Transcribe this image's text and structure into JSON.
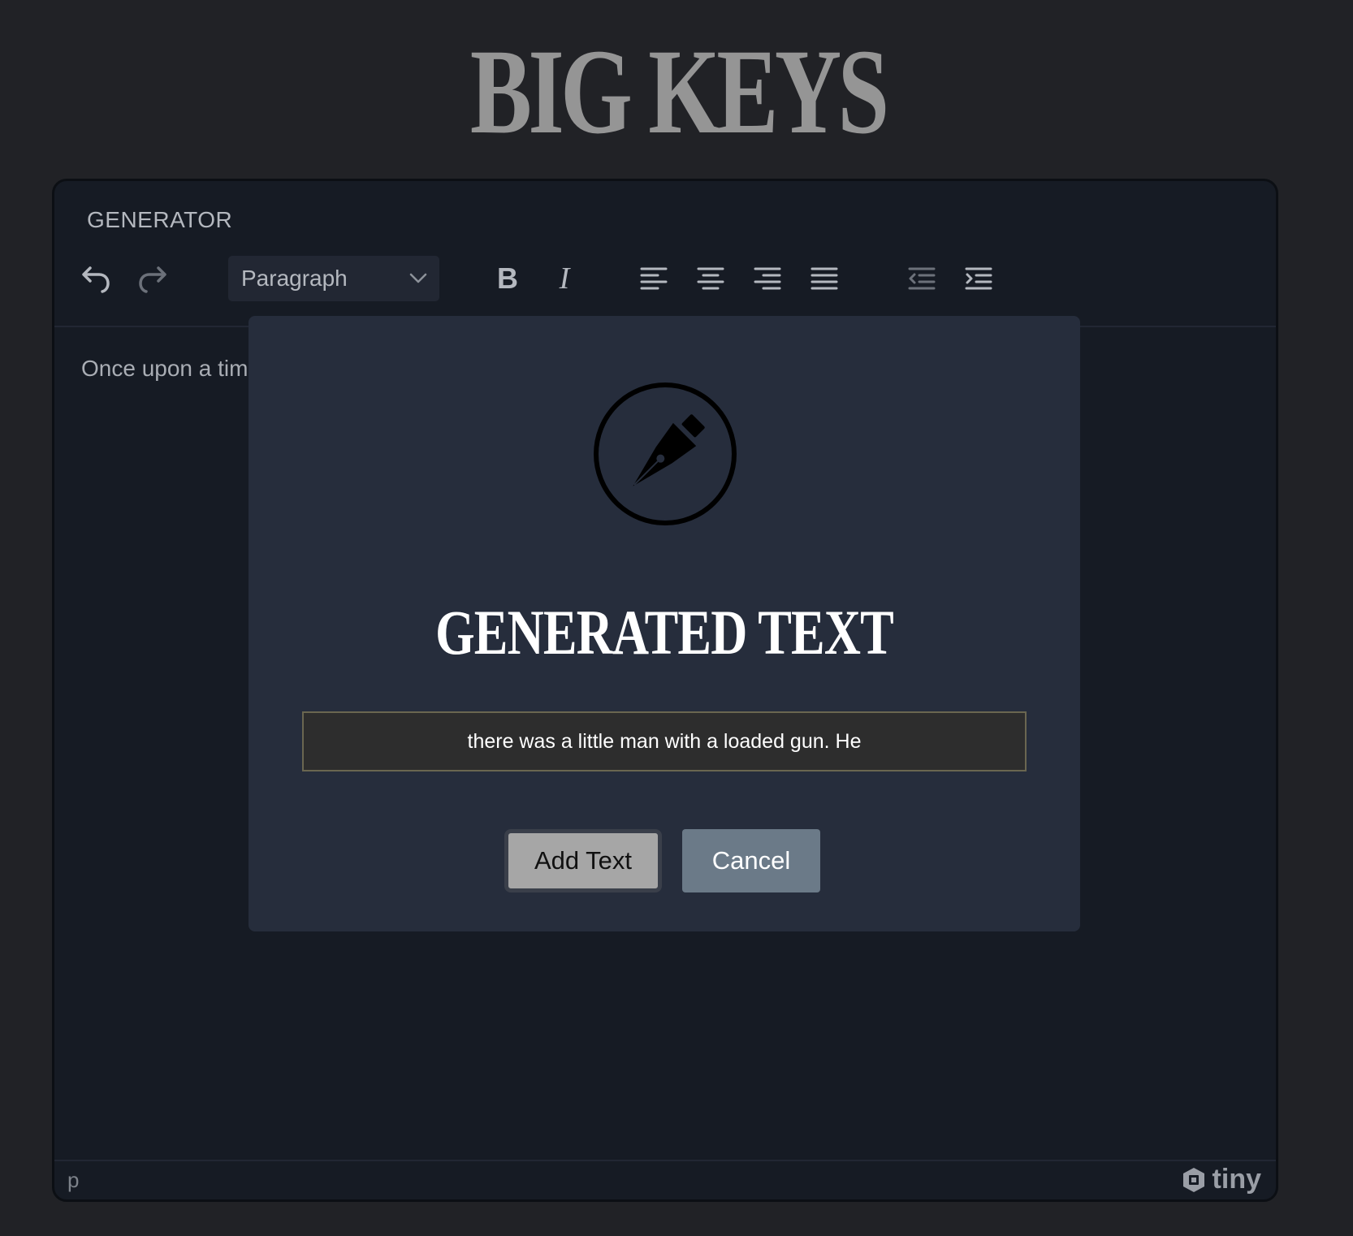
{
  "app": {
    "title": "BIG KEYS"
  },
  "editor": {
    "menubar_label": "GENERATOR",
    "toolbar": {
      "block_format": "Paragraph",
      "icons": [
        "undo-icon",
        "redo-icon",
        "bold-icon",
        "italic-icon",
        "align-left-icon",
        "align-center-icon",
        "align-right-icon",
        "align-justify-icon",
        "outdent-icon",
        "indent-icon"
      ]
    },
    "content_text": "Once upon a time",
    "status_path": "p",
    "brand": "tiny"
  },
  "modal": {
    "icon": "fountain-pen-icon",
    "title": "GENERATED TEXT",
    "generated_text": "there was a little man with a loaded gun. He",
    "add_label": "Add Text",
    "cancel_label": "Cancel"
  },
  "colors": {
    "page_bg": "#212226",
    "editor_bg": "#161b24",
    "modal_bg": "#262d3c",
    "add_button": "#a6a6a6",
    "cancel_button": "#6b7a88"
  }
}
